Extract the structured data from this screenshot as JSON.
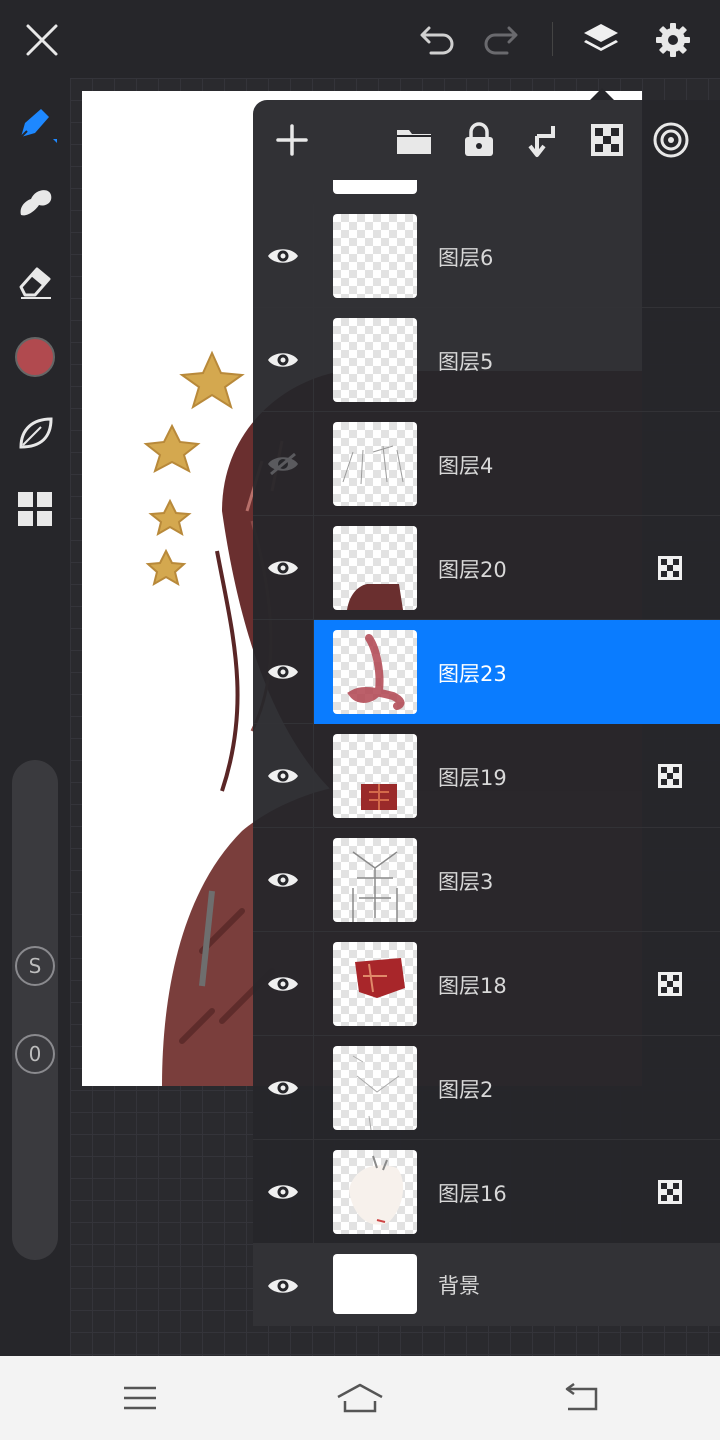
{
  "topbar": {
    "close_icon": "close-icon",
    "undo_icon": "undo-icon",
    "redo_icon": "redo-icon",
    "layers_icon": "layers-icon",
    "settings_icon": "gear-icon"
  },
  "toolbar": {
    "tools": [
      "brush-icon",
      "smudge-icon",
      "eraser-icon",
      "color-swatch",
      "leaf-icon",
      "grid-icon"
    ],
    "current_color": "#b14a4f",
    "slider_s_label": "S",
    "slider_o_label": "0"
  },
  "layers_panel": {
    "header_icons": [
      "add-layer-icon",
      "folder-icon",
      "lock-icon",
      "merge-down-icon",
      "clipping-mask-icon",
      "blend-mode-icon"
    ],
    "selected_color": "#0a7cff",
    "layers": [
      {
        "name": "图层6",
        "visible": true,
        "clipping": false
      },
      {
        "name": "图层5",
        "visible": true,
        "clipping": false
      },
      {
        "name": "图层4",
        "visible": false,
        "clipping": false
      },
      {
        "name": "图层20",
        "visible": true,
        "clipping": true
      },
      {
        "name": "图层23",
        "visible": true,
        "clipping": false,
        "selected": true
      },
      {
        "name": "图层19",
        "visible": true,
        "clipping": true
      },
      {
        "name": "图层3",
        "visible": true,
        "clipping": false
      },
      {
        "name": "图层18",
        "visible": true,
        "clipping": true
      },
      {
        "name": "图层2",
        "visible": true,
        "clipping": false
      },
      {
        "name": "图层16",
        "visible": true,
        "clipping": true
      },
      {
        "name": "背景",
        "visible": true,
        "clipping": false
      }
    ]
  },
  "navbar": {
    "menu_icon": "menu-icon",
    "home_icon": "home-icon",
    "back_icon": "back-icon"
  }
}
